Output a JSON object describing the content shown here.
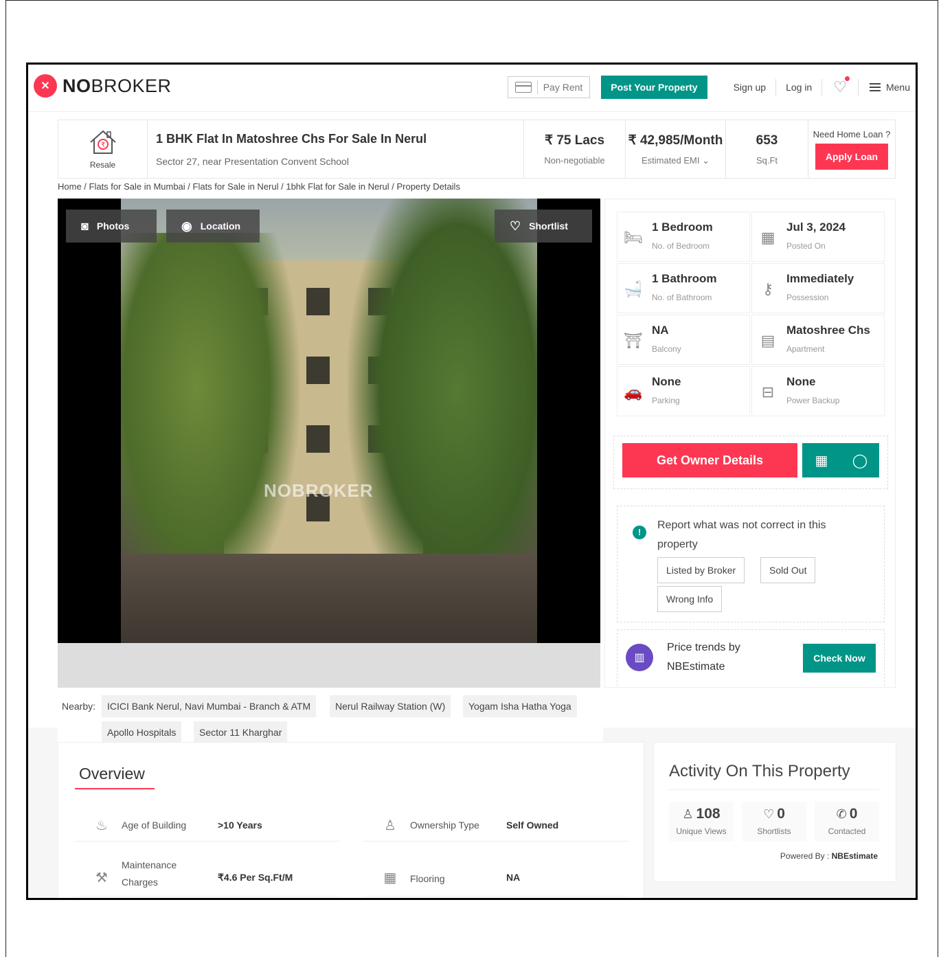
{
  "brand": {
    "no": "NO",
    "broker": "BROKER"
  },
  "nav": {
    "pay_rent": "Pay Rent",
    "post_property": "Post Your Property",
    "sign_up": "Sign up",
    "log_in": "Log in",
    "menu": "Menu"
  },
  "header": {
    "type_label": "Resale",
    "title": "1 BHK Flat In Matoshree Chs For Sale In Nerul",
    "address": "Sector 27, near Presentation Convent School",
    "price": "₹ 75 Lacs",
    "price_note": "Non-negotiable",
    "emi": "₹ 42,985/Month",
    "emi_note": "Estimated EMI",
    "area": "653",
    "area_unit": "Sq.Ft",
    "loan_question": "Need Home Loan ?",
    "apply_loan": "Apply Loan"
  },
  "breadcrumb": "Home / Flats for Sale in Mumbai / Flats for Sale in Nerul / 1bhk Flat for Sale in Nerul / Property Details",
  "gallery": {
    "photos": "Photos",
    "location": "Location",
    "shortlist": "Shortlist",
    "watermark": "NOBROKER"
  },
  "details": [
    {
      "value": "1 Bedroom",
      "label": "No. of Bedroom",
      "icon": "bed-icon"
    },
    {
      "value": "Jul 3, 2024",
      "label": "Posted On",
      "icon": "calendar-icon"
    },
    {
      "value": "1 Bathroom",
      "label": "No. of Bathroom",
      "icon": "bathtub-icon"
    },
    {
      "value": "Immediately",
      "label": "Possession",
      "icon": "key-icon"
    },
    {
      "value": "NA",
      "label": "Balcony",
      "icon": "balcony-icon"
    },
    {
      "value": "Matoshree Chs",
      "label": "Apartment",
      "icon": "building-icon"
    },
    {
      "value": "None",
      "label": "Parking",
      "icon": "car-icon"
    },
    {
      "value": "None",
      "label": "Power Backup",
      "icon": "battery-icon"
    }
  ],
  "owner": {
    "label": "Get Owner Details"
  },
  "report": {
    "text": "Report what was not correct in this property",
    "options": [
      "Listed by Broker",
      "Sold Out",
      "Wrong Info"
    ]
  },
  "trends": {
    "text_line1": "Price trends by",
    "text_line2": "NBEstimate",
    "button": "Check Now"
  },
  "nearby": {
    "label": "Nearby:",
    "places": [
      "ICICI Bank Nerul, Navi Mumbai - Branch & ATM",
      "Nerul Railway Station (W)",
      "Yogam Isha Hatha Yoga",
      "Apollo Hospitals",
      "Sector 11 Kharghar"
    ]
  },
  "overview": {
    "title": "Overview",
    "rows": [
      {
        "label": "Age of Building",
        "value": ">10 Years",
        "icon": "cake-icon"
      },
      {
        "label": "Ownership Type",
        "value": "Self Owned",
        "icon": "person-icon"
      },
      {
        "label": "Maintenance Charges",
        "value": "₹4.6 Per Sq.Ft/M",
        "icon": "tools-icon"
      },
      {
        "label": "Flooring",
        "value": "NA",
        "icon": "tiles-icon"
      }
    ]
  },
  "activity": {
    "title": "Activity On This Property",
    "stats": [
      {
        "count": "108",
        "label": "Unique Views",
        "icon": "user-icon"
      },
      {
        "count": "0",
        "label": "Shortlists",
        "icon": "heart-icon"
      },
      {
        "count": "0",
        "label": "Contacted",
        "icon": "phone-icon"
      }
    ],
    "powered_label": "Powered By :",
    "powered_by": "NBEstimate"
  },
  "colors": {
    "brand_red": "#fd3752",
    "brand_teal": "#009587"
  }
}
